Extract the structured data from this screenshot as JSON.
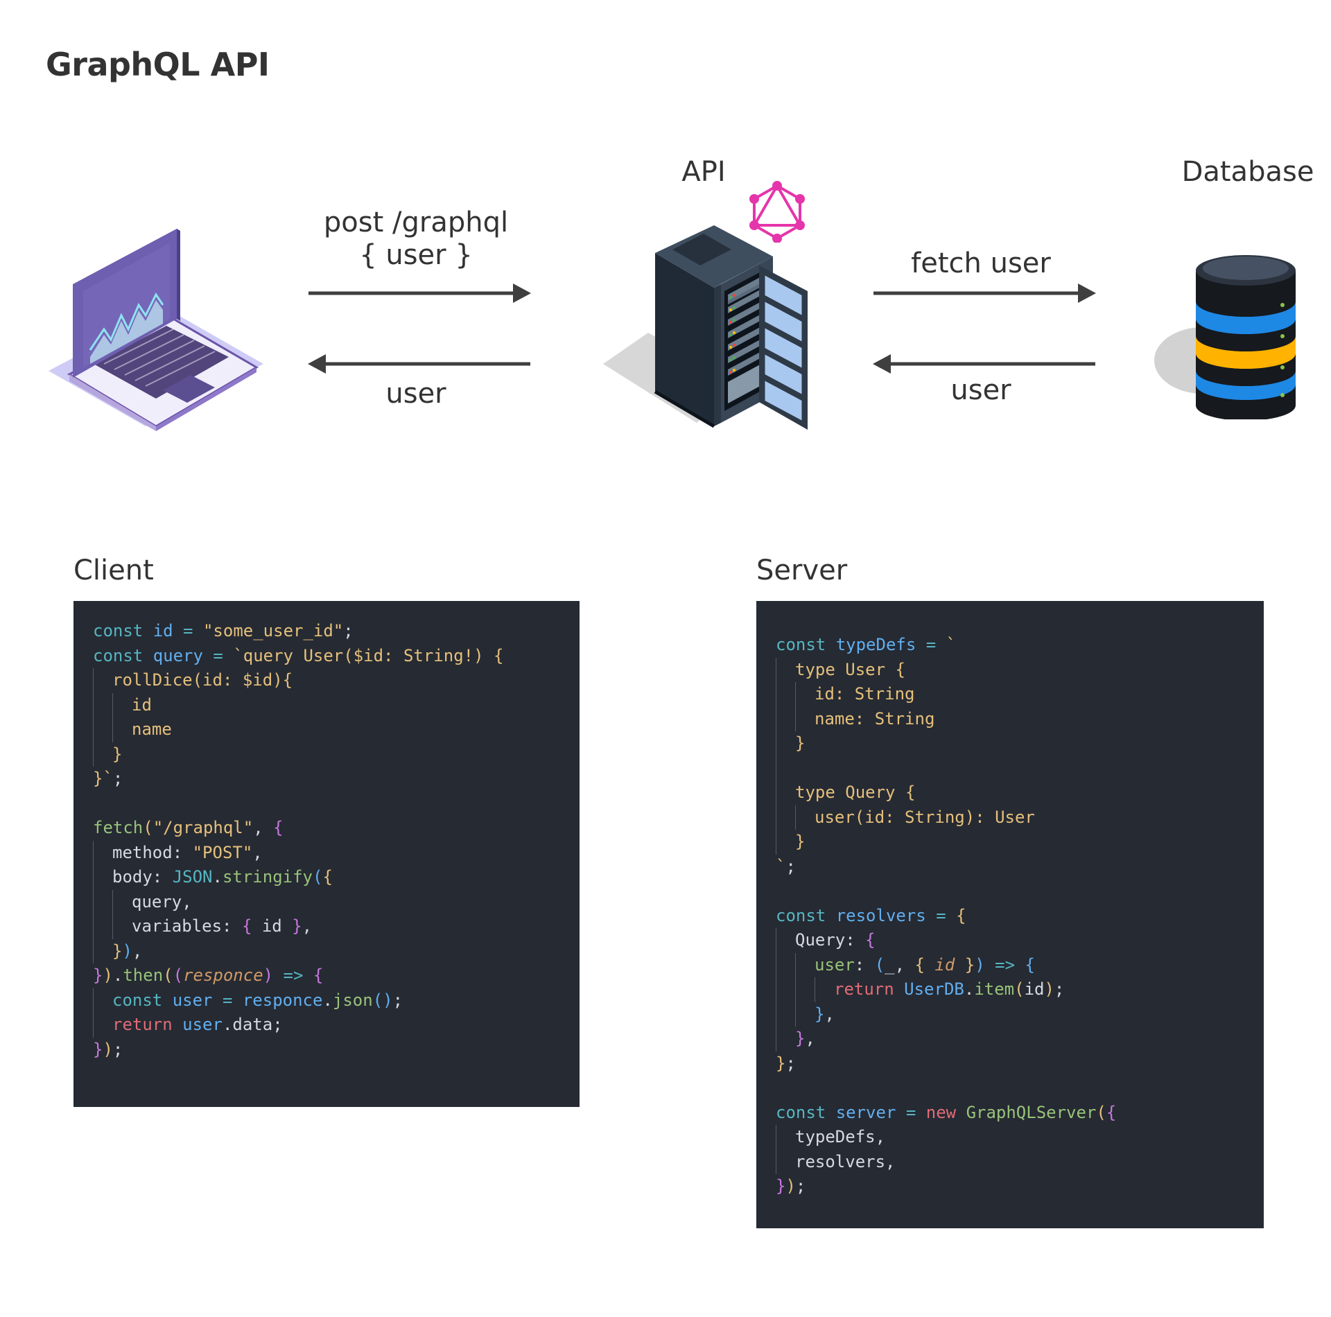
{
  "title": "GraphQL API",
  "nodes": {
    "client_icon": "laptop-icon",
    "api_label": "API",
    "api_icon": "server-rack-icon",
    "graphql_icon": "graphql-logo-icon",
    "database_label": "Database",
    "database_icon": "database-icon"
  },
  "arrows": {
    "request_line1": "post /graphql",
    "request_line2": "{ user }",
    "response_client": "user",
    "fetch": "fetch user",
    "response_db": "user"
  },
  "client": {
    "title": "Client",
    "lines": [
      {
        "indent": 0,
        "tokens": [
          [
            "t-kw",
            "const "
          ],
          [
            "t-var",
            "id"
          ],
          [
            "t-kw",
            " = "
          ],
          [
            "t-str",
            "\"some_user_id\""
          ],
          [
            "t-pun",
            ";"
          ]
        ]
      },
      {
        "indent": 0,
        "tokens": [
          [
            "t-kw",
            "const "
          ],
          [
            "t-var",
            "query"
          ],
          [
            "t-kw",
            " = "
          ],
          [
            "t-str",
            "`query User($id: String!) {"
          ]
        ]
      },
      {
        "indent": 1,
        "tokens": [
          [
            "t-str",
            "rollDice(id: $id){"
          ]
        ]
      },
      {
        "indent": 2,
        "tokens": [
          [
            "t-str",
            "id"
          ]
        ]
      },
      {
        "indent": 2,
        "tokens": [
          [
            "t-str",
            "name"
          ]
        ]
      },
      {
        "indent": 1,
        "tokens": [
          [
            "t-str",
            "}"
          ]
        ]
      },
      {
        "indent": 0,
        "tokens": [
          [
            "t-str",
            "}`"
          ],
          [
            "t-pun",
            ";"
          ]
        ]
      },
      {
        "indent": 0,
        "tokens": []
      },
      {
        "indent": 0,
        "tokens": [
          [
            "t-fn",
            "fetch"
          ],
          [
            "t-br1",
            "("
          ],
          [
            "t-str",
            "\"/graphql\""
          ],
          [
            "t-pun",
            ", "
          ],
          [
            "t-br2",
            "{"
          ]
        ]
      },
      {
        "indent": 1,
        "tokens": [
          [
            "t-prop",
            "method: "
          ],
          [
            "t-str",
            "\"POST\""
          ],
          [
            "t-pun",
            ","
          ]
        ]
      },
      {
        "indent": 1,
        "tokens": [
          [
            "t-prop",
            "body: "
          ],
          [
            "t-kw",
            "JSON"
          ],
          [
            "t-pun",
            "."
          ],
          [
            "t-fn",
            "stringify"
          ],
          [
            "t-br3",
            "("
          ],
          [
            "t-br1",
            "{"
          ]
        ]
      },
      {
        "indent": 2,
        "tokens": [
          [
            "t-prop",
            "query,"
          ]
        ]
      },
      {
        "indent": 2,
        "tokens": [
          [
            "t-prop",
            "variables: "
          ],
          [
            "t-br2",
            "{ "
          ],
          [
            "t-prop",
            "id "
          ],
          [
            "t-br2",
            "}"
          ],
          [
            "t-pun",
            ","
          ]
        ]
      },
      {
        "indent": 1,
        "tokens": [
          [
            "t-br1",
            "}"
          ],
          [
            "t-br3",
            ")"
          ],
          [
            "t-pun",
            ","
          ]
        ]
      },
      {
        "indent": 0,
        "tokens": [
          [
            "t-br2",
            "}"
          ],
          [
            "t-br1",
            ")"
          ],
          [
            "t-pun",
            "."
          ],
          [
            "t-fn",
            "then"
          ],
          [
            "t-br1",
            "("
          ],
          [
            "t-br2",
            "("
          ],
          [
            "t-param",
            "responce"
          ],
          [
            "t-br2",
            ")"
          ],
          [
            "t-kw",
            " => "
          ],
          [
            "t-br2",
            "{"
          ]
        ]
      },
      {
        "indent": 1,
        "tokens": [
          [
            "t-kw",
            "const "
          ],
          [
            "t-var",
            "user"
          ],
          [
            "t-kw",
            " = "
          ],
          [
            "t-var",
            "responce"
          ],
          [
            "t-pun",
            "."
          ],
          [
            "t-fn",
            "json"
          ],
          [
            "t-br3",
            "()"
          ],
          [
            "t-pun",
            ";"
          ]
        ]
      },
      {
        "indent": 1,
        "tokens": [
          [
            "t-ret",
            "return "
          ],
          [
            "t-var",
            "user"
          ],
          [
            "t-pun",
            ".data;"
          ]
        ]
      },
      {
        "indent": 0,
        "tokens": [
          [
            "t-br2",
            "}"
          ],
          [
            "t-br1",
            ")"
          ],
          [
            "t-pun",
            ";"
          ]
        ]
      }
    ]
  },
  "server": {
    "title": "Server",
    "lines": [
      {
        "indent": 0,
        "tokens": [
          [
            "t-kw",
            "const "
          ],
          [
            "t-var",
            "typeDefs"
          ],
          [
            "t-kw",
            " = "
          ],
          [
            "t-str",
            "`"
          ]
        ]
      },
      {
        "indent": 1,
        "tokens": [
          [
            "t-type",
            "type User {"
          ]
        ]
      },
      {
        "indent": 2,
        "tokens": [
          [
            "t-type",
            "id: String"
          ]
        ]
      },
      {
        "indent": 2,
        "tokens": [
          [
            "t-type",
            "name: String"
          ]
        ]
      },
      {
        "indent": 1,
        "tokens": [
          [
            "t-type",
            "}"
          ]
        ]
      },
      {
        "indent": 1,
        "tokens": []
      },
      {
        "indent": 1,
        "tokens": [
          [
            "t-type",
            "type Query {"
          ]
        ]
      },
      {
        "indent": 2,
        "tokens": [
          [
            "t-type",
            "user(id: String): User"
          ]
        ]
      },
      {
        "indent": 1,
        "tokens": [
          [
            "t-type",
            "}"
          ]
        ]
      },
      {
        "indent": 0,
        "tokens": [
          [
            "t-str",
            "`"
          ],
          [
            "t-pun",
            ";"
          ]
        ]
      },
      {
        "indent": 0,
        "tokens": []
      },
      {
        "indent": 0,
        "tokens": [
          [
            "t-kw",
            "const "
          ],
          [
            "t-var",
            "resolvers"
          ],
          [
            "t-kw",
            " = "
          ],
          [
            "t-br1",
            "{"
          ]
        ]
      },
      {
        "indent": 1,
        "tokens": [
          [
            "t-prop",
            "Query: "
          ],
          [
            "t-br2",
            "{"
          ]
        ]
      },
      {
        "indent": 2,
        "tokens": [
          [
            "t-fn",
            "user"
          ],
          [
            "t-pun",
            ": "
          ],
          [
            "t-br3",
            "("
          ],
          [
            "t-pun",
            "_, "
          ],
          [
            "t-br1",
            "{ "
          ],
          [
            "t-param",
            "id "
          ],
          [
            "t-br1",
            "}"
          ],
          [
            "t-br3",
            ")"
          ],
          [
            "t-kw",
            " => "
          ],
          [
            "t-br3",
            "{"
          ]
        ]
      },
      {
        "indent": 3,
        "tokens": [
          [
            "t-ret",
            "return "
          ],
          [
            "t-var",
            "UserDB"
          ],
          [
            "t-pun",
            "."
          ],
          [
            "t-fn",
            "item"
          ],
          [
            "t-br1",
            "("
          ],
          [
            "t-prop",
            "id"
          ],
          [
            "t-br1",
            ")"
          ],
          [
            "t-pun",
            ";"
          ]
        ]
      },
      {
        "indent": 2,
        "tokens": [
          [
            "t-br3",
            "}"
          ],
          [
            "t-pun",
            ","
          ]
        ]
      },
      {
        "indent": 1,
        "tokens": [
          [
            "t-br2",
            "}"
          ],
          [
            "t-pun",
            ","
          ]
        ]
      },
      {
        "indent": 0,
        "tokens": [
          [
            "t-br1",
            "}"
          ],
          [
            "t-pun",
            ";"
          ]
        ]
      },
      {
        "indent": 0,
        "tokens": []
      },
      {
        "indent": 0,
        "tokens": [
          [
            "t-kw",
            "const "
          ],
          [
            "t-var",
            "server"
          ],
          [
            "t-kw",
            " = "
          ],
          [
            "t-new",
            "new "
          ],
          [
            "t-fn",
            "GraphQLServer"
          ],
          [
            "t-br1",
            "("
          ],
          [
            "t-br2",
            "{"
          ]
        ]
      },
      {
        "indent": 1,
        "tokens": [
          [
            "t-prop",
            "typeDefs,"
          ]
        ]
      },
      {
        "indent": 1,
        "tokens": [
          [
            "t-prop",
            "resolvers,"
          ]
        ]
      },
      {
        "indent": 0,
        "tokens": [
          [
            "t-br2",
            "}"
          ],
          [
            "t-br1",
            ")"
          ],
          [
            "t-pun",
            ";"
          ]
        ]
      }
    ]
  }
}
